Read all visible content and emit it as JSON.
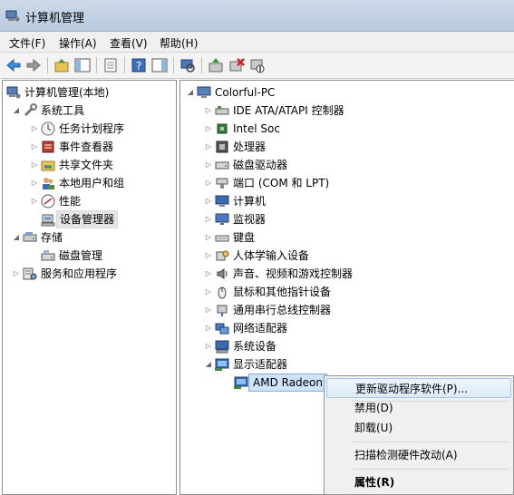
{
  "window": {
    "title": "计算机管理"
  },
  "menu": [
    "文件(F)",
    "操作(A)",
    "查看(V)",
    "帮助(H)"
  ],
  "toolbar": [
    "back-arrow-icon",
    "forward-arrow-icon",
    "up-folder-icon",
    "show-hide-tree-icon",
    "export-list-icon",
    "help-icon",
    "action-pane-icon",
    "scan-hardware-icon",
    "update-driver-icon",
    "uninstall-icon",
    "disable-device-icon"
  ],
  "left_tree": {
    "root": "计算机管理(本地)",
    "system_tools": "系统工具",
    "task_scheduler": "任务计划程序",
    "event_viewer": "事件查看器",
    "shared_folders": "共享文件夹",
    "local_users": "本地用户和组",
    "performance": "性能",
    "device_manager": "设备管理器",
    "storage": "存储",
    "disk_management": "磁盘管理",
    "services_apps": "服务和应用程序"
  },
  "right_tree": {
    "root": "Colorful-PC",
    "categories": [
      {
        "label": "IDE ATA/ATAPI 控制器",
        "icon": "ide-controller-icon"
      },
      {
        "label": "Intel Soc",
        "icon": "chip-icon"
      },
      {
        "label": "处理器",
        "icon": "processor-icon"
      },
      {
        "label": "磁盘驱动器",
        "icon": "disk-drive-icon"
      },
      {
        "label": "端口 (COM 和 LPT)",
        "icon": "port-icon"
      },
      {
        "label": "计算机",
        "icon": "computer-icon"
      },
      {
        "label": "监视器",
        "icon": "monitor-icon"
      },
      {
        "label": "键盘",
        "icon": "keyboard-icon"
      },
      {
        "label": "人体学输入设备",
        "icon": "hid-icon"
      },
      {
        "label": "声音、视频和游戏控制器",
        "icon": "speaker-icon"
      },
      {
        "label": "鼠标和其他指针设备",
        "icon": "mouse-icon"
      },
      {
        "label": "通用串行总线控制器",
        "icon": "usb-icon"
      },
      {
        "label": "网络适配器",
        "icon": "network-icon"
      },
      {
        "label": "系统设备",
        "icon": "system-device-icon"
      },
      {
        "label": "显示适配器",
        "icon": "display-adapter-icon"
      }
    ],
    "device": "AMD Radeon"
  },
  "context_menu": {
    "update_driver": "更新驱动程序软件(P)...",
    "disable": "禁用(D)",
    "uninstall": "卸载(U)",
    "scan": "扫描检测硬件改动(A)",
    "properties": "属性(R)"
  },
  "colors": {
    "selection": "#cfe3fc",
    "menu_hover": "#dcebfc",
    "titlebar": "#c4d3e6"
  }
}
